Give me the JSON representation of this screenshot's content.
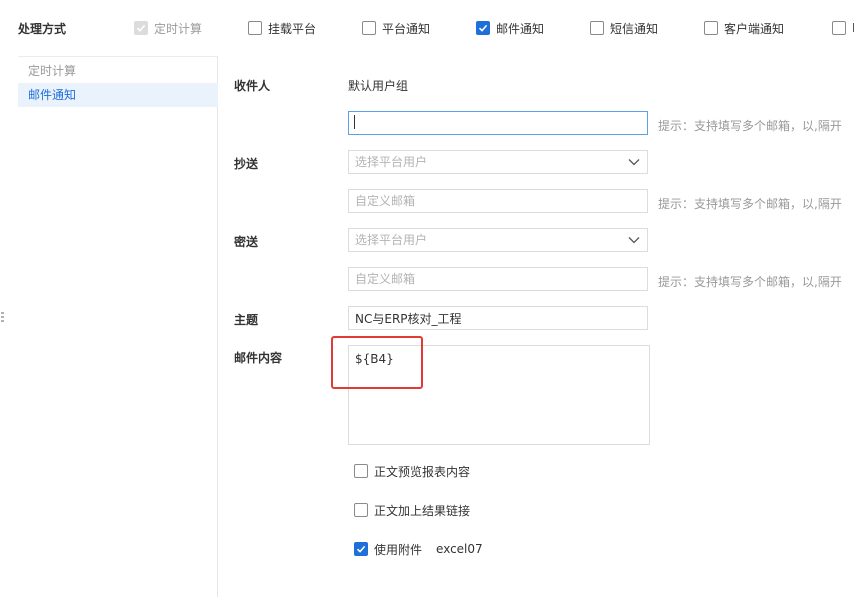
{
  "top": {
    "label": "处理方式",
    "options": [
      {
        "label": "定时计算",
        "checked": true,
        "disabled": true
      },
      {
        "label": "挂载平台",
        "checked": false
      },
      {
        "label": "平台通知",
        "checked": false
      },
      {
        "label": "邮件通知",
        "checked": true
      },
      {
        "label": "短信通知",
        "checked": false
      },
      {
        "label": "客户端通知",
        "checked": false
      },
      {
        "label": "F",
        "checked": false
      }
    ]
  },
  "sidebar": {
    "items": [
      {
        "label": "定时计算",
        "active": false
      },
      {
        "label": "邮件通知",
        "active": true
      }
    ]
  },
  "form": {
    "recipient_label": "收件人",
    "recipient_default": "默认用户组",
    "recipient_input_value": "",
    "cc_label": "抄送",
    "cc_select_placeholder": "选择平台用户",
    "cc_input_placeholder": "自定义邮箱",
    "bcc_label": "密送",
    "bcc_select_placeholder": "选择平台用户",
    "bcc_input_placeholder": "自定义邮箱",
    "hint": "提示：支持填写多个邮箱，以,隔开",
    "subject_label": "主题",
    "subject_value": "NC与ERP核对_工程",
    "content_label": "邮件内容",
    "content_value": "${B4}",
    "options": {
      "preview_label": "正文预览报表内容",
      "link_label": "正文加上结果链接",
      "attachment_label": "使用附件",
      "attachment_format": "excel07"
    }
  }
}
